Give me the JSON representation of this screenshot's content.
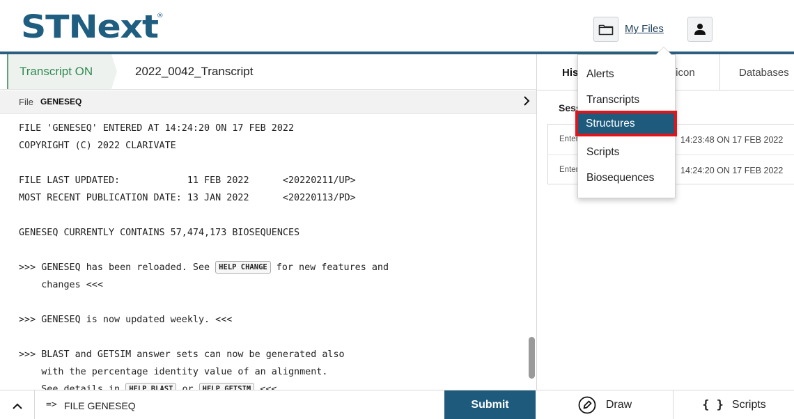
{
  "app": {
    "logo": "STNext",
    "logo_mark": "®",
    "my_files_label": "My Files"
  },
  "transcript": {
    "status_label": "Transcript ON",
    "name": "2022_0042_Transcript",
    "file_label": "File",
    "file_name": "GENESEQ"
  },
  "output": {
    "line1": "FILE 'GENESEQ' ENTERED AT 14:24:20 ON 17 FEB 2022",
    "line2": "COPYRIGHT (C) 2022 CLARIVATE",
    "line3": "FILE LAST UPDATED:            11 FEB 2022      <20220211/UP>",
    "line4": "MOST RECENT PUBLICATION DATE: 13 JAN 2022      <20220113/PD>",
    "line5": "GENESEQ CURRENTLY CONTAINS 57,474,173 BIOSEQUENCES",
    "line6_a": ">>> GENESEQ has been reloaded. See ",
    "line6_cmd": "HELP CHANGE",
    "line6_b": " for new features and",
    "line7": "    changes <<<",
    "line8": ">>> GENESEQ is now updated weekly. <<<",
    "line9": ">>> BLAST and GETSIM answer sets can now be generated also",
    "line10": "    with the percentage identity value of an alignment.",
    "line11_a": "    See details in ",
    "line11_cmd1": "HELP BLAST",
    "line11_or": " or ",
    "line11_cmd2": "HELP GETSIM",
    "line11_b": " <<<"
  },
  "command_bar": {
    "prompt": "=>",
    "input_value": "FILE GENESEQ",
    "submit_label": "Submit",
    "draw_label": "Draw",
    "scripts_label": "Scripts"
  },
  "right_panel": {
    "tabs": [
      "History",
      "Lexicon",
      "Databases"
    ],
    "session_label": "Session",
    "history": [
      {
        "action": "Entered",
        "time": "14:23:48 ON 17 FEB 2022"
      },
      {
        "action": "Entered",
        "time": "14:24:20 ON 17 FEB 2022"
      }
    ]
  },
  "files_menu": {
    "items": [
      "Alerts",
      "Transcripts",
      "Structures",
      "Scripts",
      "Biosequences"
    ],
    "highlighted": "Structures"
  },
  "colors": {
    "brand_blue": "#1f5e80",
    "transcript_green": "#2f8a52",
    "submit_bg": "#1d5a7c",
    "highlight_border": "#e0141a"
  }
}
